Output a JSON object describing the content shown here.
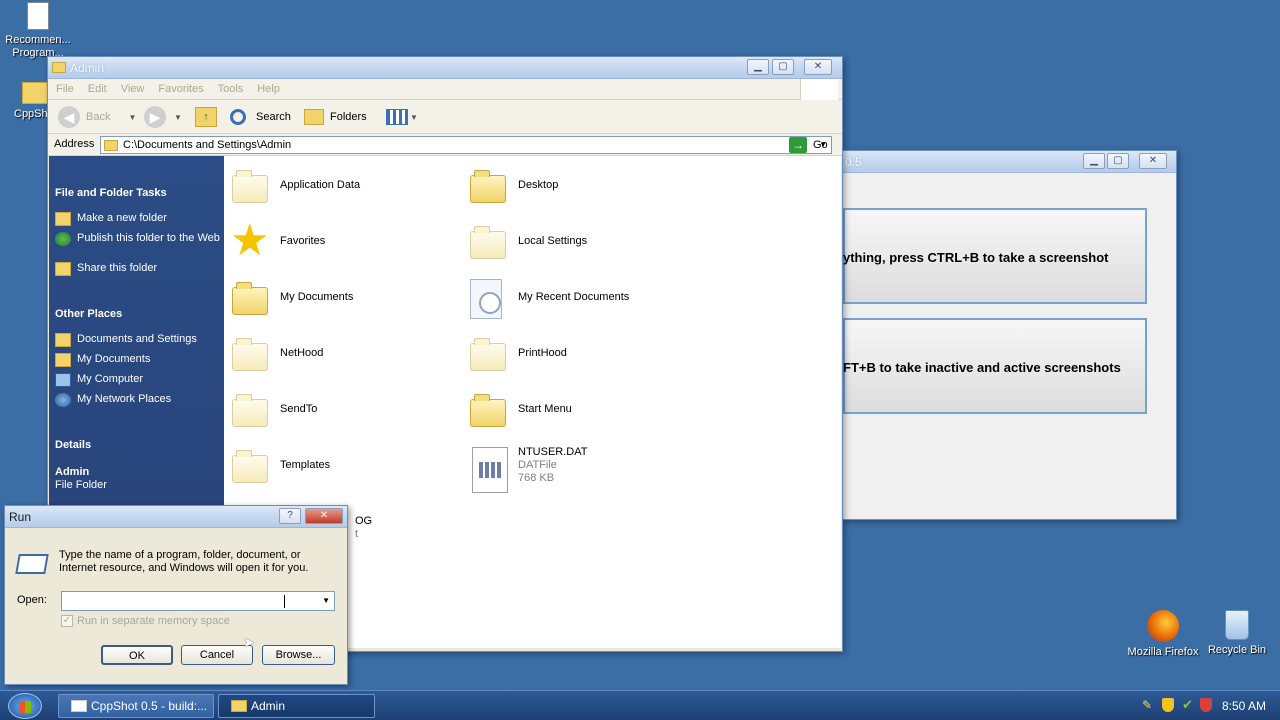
{
  "desktop": {
    "icons": [
      {
        "label": "Recommen... Program..."
      },
      {
        "label": "CppSho..."
      },
      {
        "label": "Mozilla Firefox"
      },
      {
        "label": "Recycle Bin"
      }
    ]
  },
  "explorer": {
    "title": "Admin",
    "menu": [
      "File",
      "Edit",
      "View",
      "Favorites",
      "Tools",
      "Help"
    ],
    "toolbar": {
      "back": "Back",
      "search": "Search",
      "folders": "Folders"
    },
    "address": {
      "label": "Address",
      "value": "C:\\Documents and Settings\\Admin",
      "go": "Go"
    },
    "sidebar": {
      "tasks_title": "File and Folder Tasks",
      "tasks": [
        "Make a new folder",
        "Publish this folder to the Web",
        "Share this folder"
      ],
      "places_title": "Other Places",
      "places": [
        "Documents and Settings",
        "My Documents",
        "My Computer",
        "My Network Places"
      ],
      "details_title": "Details",
      "details_name": "Admin",
      "details_type": "File Folder"
    },
    "files": [
      {
        "name": "Application Data",
        "icon": "folder-pale-icon"
      },
      {
        "name": "Desktop",
        "icon": "folder-icon"
      },
      {
        "name": "Favorites",
        "icon": "star-icon"
      },
      {
        "name": "Local Settings",
        "icon": "folder-pale-icon"
      },
      {
        "name": "My Documents",
        "icon": "folder-icon"
      },
      {
        "name": "My Recent Documents",
        "icon": "recent-documents-icon"
      },
      {
        "name": "NetHood",
        "icon": "folder-pale-icon"
      },
      {
        "name": "PrintHood",
        "icon": "folder-pale-icon"
      },
      {
        "name": "SendTo",
        "icon": "folder-pale-icon"
      },
      {
        "name": "Start Menu",
        "icon": "folder-icon"
      },
      {
        "name": "Templates",
        "icon": "folder-pale-icon"
      },
      {
        "name": "NTUSER.DAT",
        "icon": "dat-file-icon",
        "type": "DATFile",
        "size": "768 KB"
      }
    ],
    "partial_file": {
      "name": "OG",
      "type": "t"
    }
  },
  "cppshot": {
    "title": "0.5",
    "line1": "ything, press CTRL+B to take a screenshot",
    "line2": "FT+B to take inactive and active screenshots"
  },
  "run_dialog": {
    "title": "Run",
    "help_glyph": "?",
    "description": "Type the name of a program, folder, document, or Internet resource, and Windows will open it for you.",
    "open_label": "Open:",
    "open_value": "",
    "checkbox_label": "Run in separate memory space",
    "ok": "OK",
    "cancel": "Cancel",
    "browse": "Browse..."
  },
  "taskbar": {
    "tasks": [
      {
        "label": "CppShot 0.5 - build:..."
      },
      {
        "label": "Admin"
      }
    ],
    "clock": "8:50 AM"
  },
  "colors": {
    "desktop": "#3a6ea5",
    "sidebar": "#2b4c86",
    "taskbar": "#1d3f73"
  }
}
